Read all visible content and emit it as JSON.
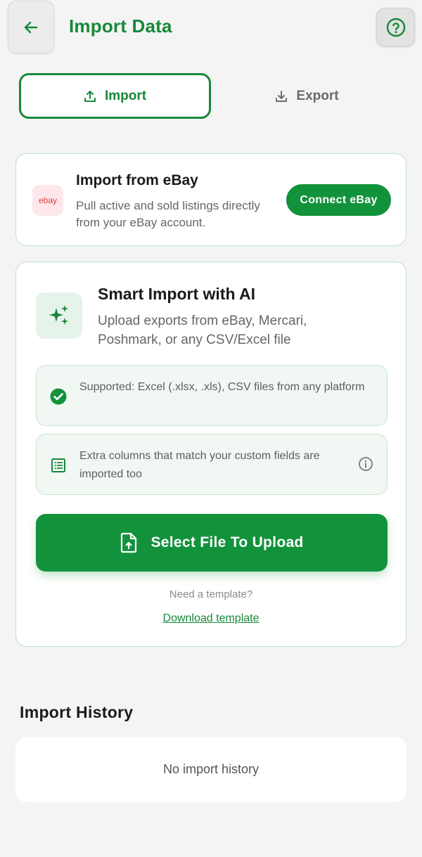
{
  "header": {
    "title": "Import Data"
  },
  "tabs": {
    "import_label": "Import",
    "export_label": "Export"
  },
  "ebay": {
    "logo_text": "ebay",
    "title": "Import from eBay",
    "description": "Pull active and sold listings directly from your eBay account.",
    "connect_label": "Connect eBay"
  },
  "smart_import": {
    "title": "Smart Import with AI",
    "description": "Upload exports from eBay, Mercari, Poshmark, or any CSV/Excel file",
    "supported_text": "Supported: Excel (.xlsx, .xls), CSV files from any platform",
    "extra_columns_text": "Extra columns that match your custom fields are imported too",
    "upload_label": "Select File To Upload",
    "template_question": "Need a template?",
    "template_link": "Download template"
  },
  "history": {
    "title": "Import History",
    "empty_text": "No import history"
  },
  "colors": {
    "brand_green": "#13923c",
    "title_green": "#16883a",
    "ebay_red": "#e23a45"
  }
}
